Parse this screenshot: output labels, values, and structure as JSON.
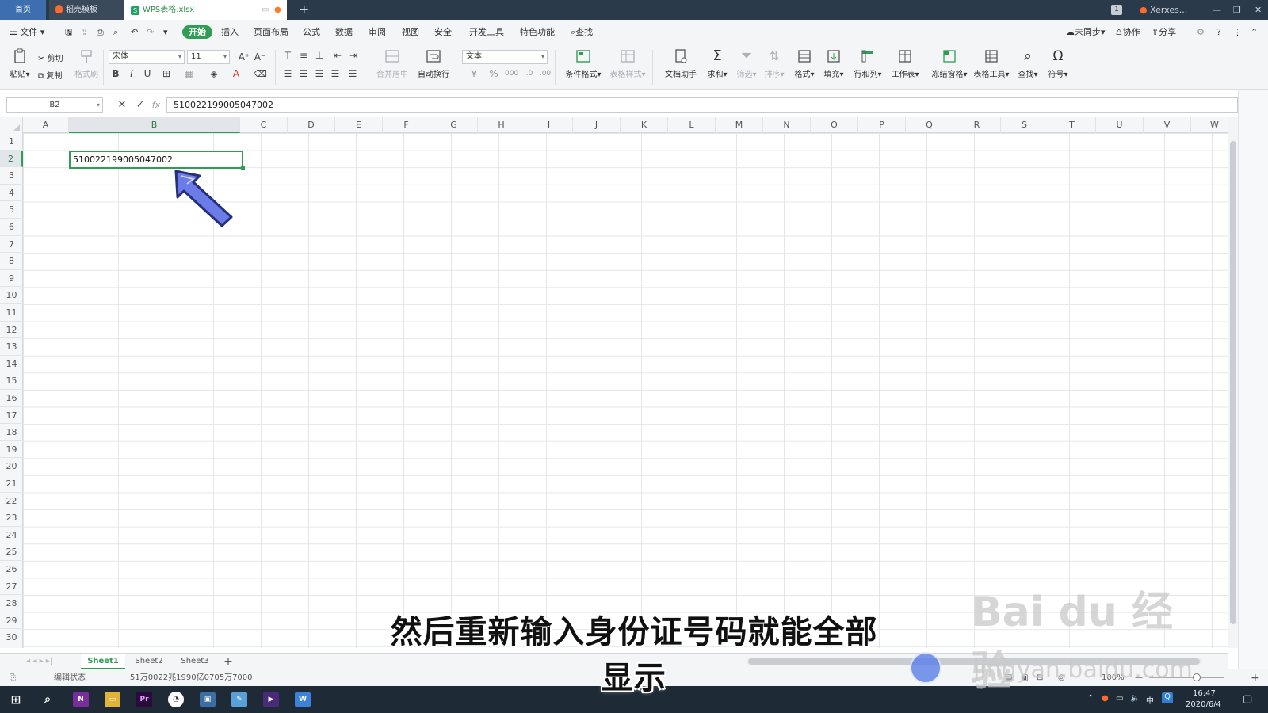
{
  "window": {
    "tabs": [
      {
        "label": "首页"
      },
      {
        "label": "稻壳模板"
      },
      {
        "label": "WPS表格.xlsx"
      }
    ],
    "badge": "1",
    "user": "Xerxes..."
  },
  "menu": {
    "file": "文件",
    "items": [
      "开始",
      "插入",
      "页面布局",
      "公式",
      "数据",
      "审阅",
      "视图",
      "安全",
      "开发工具",
      "特色功能"
    ],
    "search": "查找",
    "sync": "未同步",
    "collab": "协作",
    "share": "分享"
  },
  "ribbon": {
    "paste": "粘贴",
    "cut": "剪切",
    "copy": "复制",
    "format_painter": "格式刷",
    "font_name": "宋体",
    "font_size": "11",
    "merge_center": "合并居中",
    "wrap_text": "自动换行",
    "number_format": "文本",
    "conditional_format": "条件格式",
    "table_style": "表格样式",
    "doc_assistant": "文档助手",
    "sum": "求和",
    "filter": "筛选",
    "sort": "排序",
    "format": "格式",
    "fill": "填充",
    "row_col": "行和列",
    "worksheet": "工作表",
    "freeze": "冻结窗格",
    "table_tools": "表格工具",
    "find": "查找",
    "symbol": "符号"
  },
  "formula_bar": {
    "cell_ref": "B2",
    "fx": "fx",
    "value": "510022199005047002"
  },
  "grid": {
    "columns": [
      "A",
      "B",
      "C",
      "D",
      "E",
      "F",
      "G",
      "H",
      "I",
      "J",
      "K",
      "L",
      "M",
      "N",
      "O",
      "P",
      "Q",
      "R",
      "S",
      "T",
      "U",
      "V",
      "W"
    ],
    "rows": [
      "1",
      "2",
      "3",
      "4",
      "5",
      "6",
      "7",
      "8",
      "9",
      "10",
      "11",
      "12",
      "13",
      "14",
      "15",
      "16",
      "17",
      "18",
      "19",
      "20",
      "21",
      "22",
      "23",
      "24",
      "25",
      "26",
      "27",
      "28",
      "29",
      "30"
    ],
    "active_cell": "B2",
    "active_value": "510022199005047002"
  },
  "sheets": [
    "Sheet1",
    "Sheet2",
    "Sheet3"
  ],
  "status": {
    "mode": "编辑状态",
    "readout": "51万0022兆1990亿0705万7000",
    "zoom": "100%"
  },
  "taskbar": {
    "time": "16:47",
    "date": "2020/6/4",
    "ime": "中"
  },
  "overlay": {
    "subtitle": "然后重新输入身份证号码就能全部显示",
    "watermark": "Bai du 经验",
    "watermark_url": "jingyan.baidu.com"
  },
  "colors": {
    "accent": "#2f9d54",
    "titlebar": "#2b3a4a",
    "arrow": "#6b7be8"
  }
}
